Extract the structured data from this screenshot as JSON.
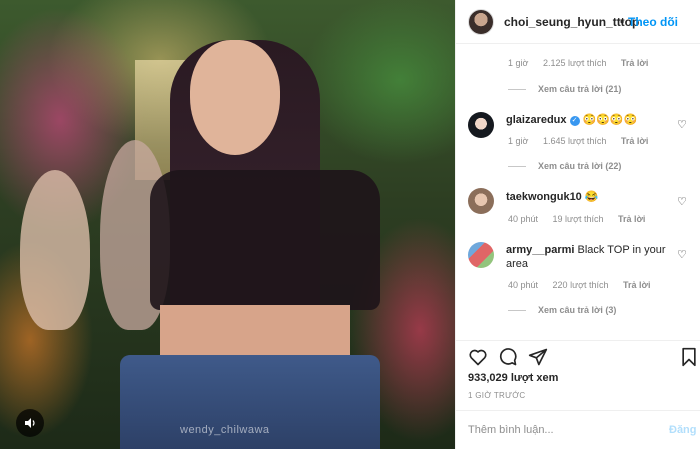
{
  "media": {
    "watermark": "wendy_chilwawa",
    "sound_icon": "speaker-icon"
  },
  "header": {
    "username": "choi_seung_hyun_tttop",
    "separator": "•",
    "follow_label": "Theo dõi"
  },
  "comments": [
    {
      "username": "",
      "text": "",
      "time": "1 giờ",
      "likes": "2.125 lượt thích",
      "reply": "Trả lời",
      "view_replies": "Xem câu trả lời (21)"
    },
    {
      "username": "glaizaredux",
      "verified": true,
      "text": "😳😳😳😳",
      "time": "1 giờ",
      "likes": "1.645 lượt thích",
      "reply": "Trả lời",
      "view_replies": "Xem câu trả lời (22)"
    },
    {
      "username": "taekwonguk10",
      "text": "😂",
      "time": "40 phút",
      "likes": "19 lượt thích",
      "reply": "Trả lời",
      "view_replies": ""
    },
    {
      "username": "army__parmi",
      "text": "Black TOP in your area",
      "time": "40 phút",
      "likes": "220 lượt thích",
      "reply": "Trả lời",
      "view_replies": "Xem câu trả lời (3)"
    }
  ],
  "actions": {
    "like_icon": "heart-icon",
    "comment_icon": "comment-icon",
    "share_icon": "share-icon",
    "save_icon": "bookmark-icon"
  },
  "stats": {
    "views": "933,029 lượt xem",
    "posted": "1 GIỜ TRƯỚC"
  },
  "add_comment": {
    "placeholder": "Thêm bình luận...",
    "post_label": "Đăng"
  },
  "colors": {
    "accent": "#0095f6",
    "verified": "#3897f0",
    "muted": "#8e8e8e"
  }
}
